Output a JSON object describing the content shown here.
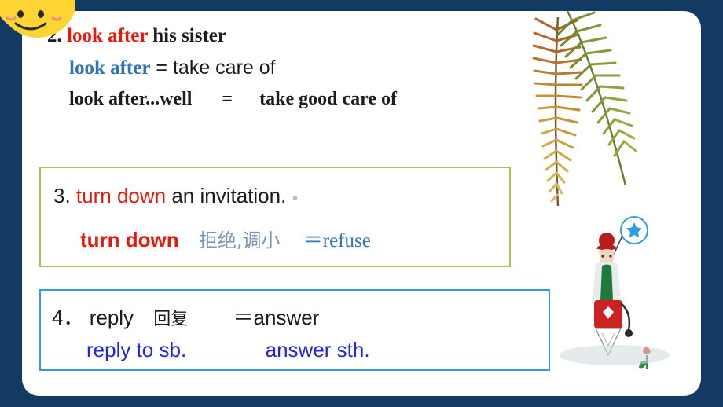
{
  "slide": {
    "background_color": "#123a63",
    "card_color": "#ffffff"
  },
  "items": {
    "item2": {
      "number": "2.",
      "phrase": "look after",
      "rest": "his sister",
      "definition_term": "look after",
      "definition_equals": "=",
      "definition_meaning": "take care of",
      "extended": "look after...well",
      "extended_equals": "=",
      "extended_meaning": "take good care of"
    },
    "item3": {
      "number": "3.",
      "phrase": "turn down",
      "rest": "an invitation.",
      "phrase_repeat": "turn down",
      "chinese": "拒绝,调小",
      "equals_refuse": "＝refuse"
    },
    "item4": {
      "number": "4．",
      "word": "reply",
      "chinese": "回复",
      "equals_answer": "＝answer",
      "collocation_left": "reply to sb.",
      "collocation_right": "answer sth."
    }
  },
  "colors": {
    "red": "#e8180c",
    "blue_term": "#2f75b5",
    "blue_text": "#2222ee",
    "chinese_grey_blue": "#7f93b5",
    "green_border": "#a5c452",
    "blue_border": "#2f9de0",
    "slide_bg": "#123a63"
  },
  "decorations": {
    "sun": "sun-smiley-icon",
    "fern_left": "fern-leaf-icon",
    "fern_right": "fern-leaf-icon",
    "badge": "star-badge-icon",
    "character": "girl-cartoon-icon",
    "flower": "tulip-icon"
  }
}
